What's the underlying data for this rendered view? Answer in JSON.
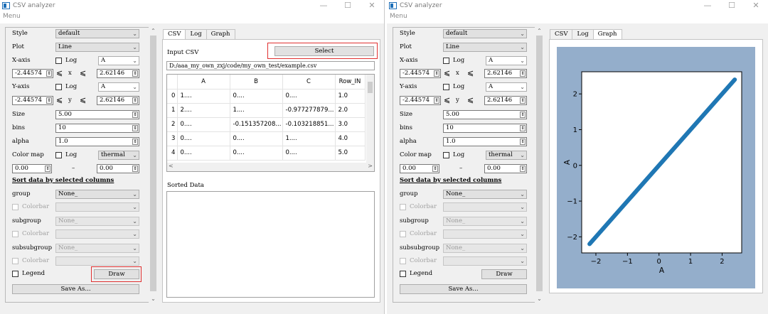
{
  "window": {
    "title": "CSV analyzer",
    "menu": "Menu",
    "ctrl_min": "—",
    "ctrl_max": "☐",
    "ctrl_close": "✕"
  },
  "settings": {
    "style_label": "Style",
    "style_value": "default",
    "plot_label": "Plot",
    "plot_value": "Line",
    "xaxis_label": "X-axis",
    "log_label": "Log",
    "x_scale_value": "A",
    "x_min": "-2.44574",
    "x_var": "x",
    "x_max": "2.62146",
    "yaxis_label": "Y-axis",
    "y_scale_value": "A",
    "y_min": "-2.44574",
    "y_var": "y",
    "y_max": "2.62146",
    "less_eq": "⩽",
    "size_label": "Size",
    "size_value": "5.00",
    "bins_label": "bins",
    "bins_value": "10",
    "alpha_label": "alpha",
    "alpha_value": "1.0",
    "colormap_label": "Color map",
    "colormap_value": "thermal",
    "cmap_min": "0.00",
    "cmap_dash": "–",
    "cmap_max": "0.00",
    "sort_header": "Sort data by selected columns",
    "group_label": "group",
    "group_value": "None_",
    "colorbar_label": "Colorbar",
    "subgroup_label": "subgroup",
    "subgroup_value": "None_",
    "subsubgroup_label": "subsubgroup",
    "subsubgroup_value": "None_",
    "legend_label": "Legend",
    "draw_label": "Draw",
    "saveas_label": "Save As..."
  },
  "tabs": [
    "CSV",
    "Log",
    "Graph"
  ],
  "csv": {
    "input_label": "Input CSV",
    "select_label": "Select",
    "path": "D:/aaa_my_own_zxj/code/my_own_test/example.csv",
    "columns": [
      "A",
      "B",
      "C",
      "Row_IN"
    ],
    "rows": [
      {
        "idx": "0",
        "cells": [
          "1....",
          "0....",
          "0....",
          "1.0"
        ]
      },
      {
        "idx": "1",
        "cells": [
          "2....",
          "1....",
          "-0.977277879...",
          "2.0"
        ]
      },
      {
        "idx": "2",
        "cells": [
          "0....",
          "-0.151357208...",
          "-0.103218851...",
          "3.0"
        ]
      },
      {
        "idx": "3",
        "cells": [
          "0....",
          "0....",
          "1....",
          "4.0"
        ]
      },
      {
        "idx": "4",
        "cells": [
          "0....",
          "0....",
          "0....",
          "5.0"
        ]
      }
    ],
    "sorted_label": "Sorted Data"
  },
  "chart_data": {
    "type": "scatter",
    "xlabel": "A",
    "ylabel": "A",
    "x_ticks": [
      -2,
      -1,
      0,
      1,
      2
    ],
    "y_ticks": [
      -2,
      -1,
      0,
      1,
      2
    ],
    "xlim": [
      -2.45,
      2.62
    ],
    "ylim": [
      -2.45,
      2.62
    ],
    "series": [
      {
        "x_range": [
          -2.2,
          2.4
        ],
        "relation": "y = x"
      }
    ],
    "color": "#1f77b4",
    "background": "#94aecb"
  }
}
